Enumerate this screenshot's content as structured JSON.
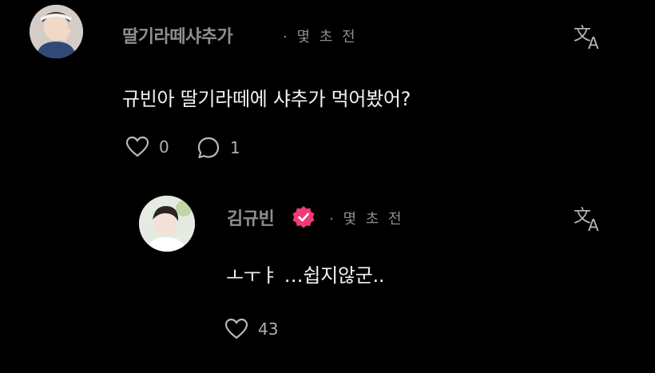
{
  "colors": {
    "background": "#000000",
    "primary_text": "#f2f2f2",
    "secondary_text": "#8e8e93",
    "verified_badge": "#f0397a"
  },
  "comment": {
    "username": "딸기라떼샤추가",
    "meta": "· 몇 초 전",
    "text": "규빈아 딸기라떼에 샤추가 먹어봤어?",
    "like_count": "0",
    "reply_count": "1",
    "icons": [
      "avatar",
      "translate-icon",
      "heart-icon",
      "comment-bubble-icon"
    ]
  },
  "reply": {
    "username": "김규빈",
    "verified": true,
    "meta": "· 몇 초 전",
    "text": "ㅗㅜㅑ …쉽지않군..",
    "like_count": "43",
    "icons": [
      "avatar",
      "verified-badge-icon",
      "translate-icon",
      "heart-icon"
    ]
  }
}
